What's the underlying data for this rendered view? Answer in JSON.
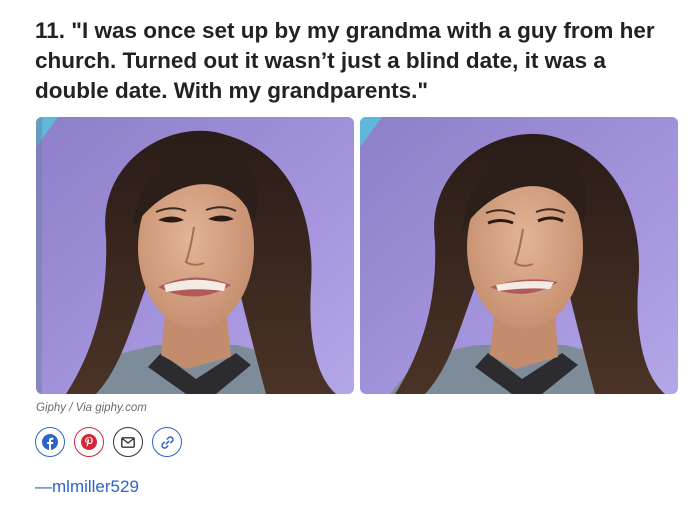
{
  "item": {
    "headline": "11. \"I was once set up by my grandma with a guy from her church. Turned out it wasn’t just a blind date, it was a double date. With my grandparents.\""
  },
  "media": {
    "frames": [
      {
        "alt": "Woman grimacing awkwardly"
      },
      {
        "alt": "Woman wincing awkwardly"
      }
    ],
    "credit": "Giphy / Via giphy.com"
  },
  "share": {
    "buttons": [
      {
        "icon": "facebook-icon",
        "color": "#2d63c8"
      },
      {
        "icon": "pinterest-icon",
        "color": "#d2283a"
      },
      {
        "icon": "mail-icon",
        "color": "#333333"
      },
      {
        "icon": "link-icon",
        "color": "#2d63c8"
      }
    ]
  },
  "attribution": {
    "author": "—mlmiller529"
  },
  "colors": {
    "headline": "#222222",
    "link": "#2d63c8",
    "background_purple": "#a996e0"
  }
}
